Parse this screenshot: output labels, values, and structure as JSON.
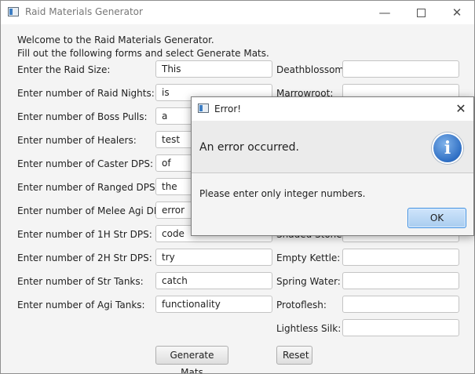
{
  "window": {
    "title": "Raid Materials Generator"
  },
  "intro": {
    "line1": "Welcome to the Raid Materials Generator.",
    "line2": "Fill out the following forms and select Generate Mats."
  },
  "left_fields": [
    {
      "label": "Enter the Raid Size:",
      "value": "This"
    },
    {
      "label": "Enter number of Raid Nights:",
      "value": "is"
    },
    {
      "label": "Enter number of Boss Pulls:",
      "value": "a"
    },
    {
      "label": "Enter number of Healers:",
      "value": "test"
    },
    {
      "label": "Enter number of Caster DPS:",
      "value": "of"
    },
    {
      "label": "Enter number of Ranged DPS:",
      "value": "the"
    },
    {
      "label": "Enter number of Melee Agi DPS:",
      "value": "error"
    },
    {
      "label": "Enter number of 1H Str DPS:",
      "value": "code"
    },
    {
      "label": "Enter number of 2H Str DPS:",
      "value": "try"
    },
    {
      "label": "Enter number of Str Tanks:",
      "value": "catch"
    },
    {
      "label": "Enter number of Agi Tanks:",
      "value": "functionality"
    }
  ],
  "right_fields": [
    {
      "label": "Deathblossom:",
      "value": ""
    },
    {
      "label": "Marrowroot:",
      "value": ""
    },
    {
      "label": "Empty Kettle:",
      "value": ""
    },
    {
      "label": "Spring Water:",
      "value": ""
    },
    {
      "label": "Protoflesh:",
      "value": ""
    },
    {
      "label": "Lightless Silk:",
      "value": ""
    }
  ],
  "right_partial_label": "Shaded Stone:",
  "buttons": {
    "generate": "Generate Mats",
    "reset": "Reset"
  },
  "dialog": {
    "title": "Error!",
    "header": "An error occurred.",
    "icon_glyph": "i",
    "content": "Please enter only integer numbers.",
    "ok": "OK"
  },
  "colors": {
    "accent": "#3d8ee0",
    "info_icon": "#2f6fc4"
  }
}
